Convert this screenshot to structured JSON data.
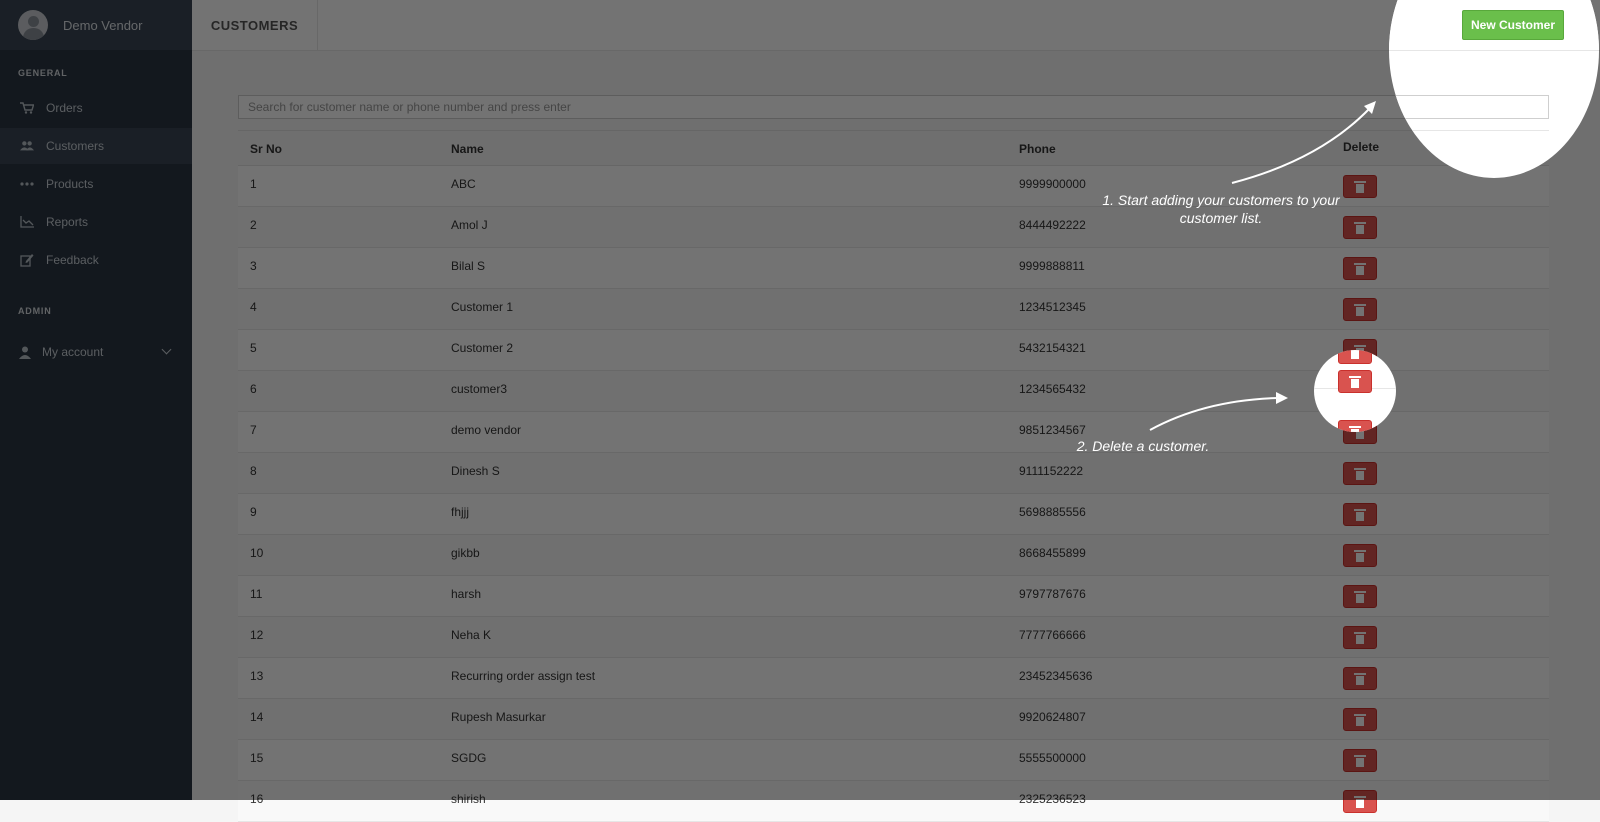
{
  "sidebar": {
    "user_name": "Demo Vendor",
    "section_general": "GENERAL",
    "section_admin": "ADMIN",
    "items": [
      {
        "label": "Orders",
        "icon": "cart-icon"
      },
      {
        "label": "Customers",
        "icon": "users-icon",
        "active": true
      },
      {
        "label": "Products",
        "icon": "dots-icon"
      },
      {
        "label": "Reports",
        "icon": "chart-icon"
      },
      {
        "label": "Feedback",
        "icon": "edit-icon"
      }
    ],
    "account_label": "My account"
  },
  "header": {
    "title": "CUSTOMERS",
    "new_customer_label": "New Customer"
  },
  "search": {
    "placeholder": "Search for customer name or phone number and press enter"
  },
  "table": {
    "columns": [
      "Sr No",
      "Name",
      "Phone",
      "Delete"
    ],
    "rows": [
      {
        "sr": "1",
        "name": "ABC",
        "phone": "9999900000"
      },
      {
        "sr": "2",
        "name": "Amol J",
        "phone": "8444492222"
      },
      {
        "sr": "3",
        "name": "Bilal S",
        "phone": "9999888811"
      },
      {
        "sr": "4",
        "name": "Customer 1",
        "phone": "1234512345"
      },
      {
        "sr": "5",
        "name": "Customer 2",
        "phone": "5432154321"
      },
      {
        "sr": "6",
        "name": "customer3",
        "phone": "1234565432"
      },
      {
        "sr": "7",
        "name": "demo vendor",
        "phone": "9851234567"
      },
      {
        "sr": "8",
        "name": "Dinesh S",
        "phone": "9111152222"
      },
      {
        "sr": "9",
        "name": "fhjjj",
        "phone": "5698885556"
      },
      {
        "sr": "10",
        "name": "gikbb",
        "phone": "8668455899"
      },
      {
        "sr": "11",
        "name": "harsh",
        "phone": "9797787676"
      },
      {
        "sr": "12",
        "name": "Neha K",
        "phone": "7777766666"
      },
      {
        "sr": "13",
        "name": "Recurring order assign test",
        "phone": "23452345636"
      },
      {
        "sr": "14",
        "name": "Rupesh Masurkar",
        "phone": "9920624807"
      },
      {
        "sr": "15",
        "name": "SGDG",
        "phone": "5555500000"
      },
      {
        "sr": "16",
        "name": "shirish",
        "phone": "2325236523"
      }
    ]
  },
  "tour": {
    "step1": "1. Start adding your customers to your customer list.",
    "step2": "2. Delete a customer."
  },
  "colors": {
    "sidebar_bg": "#2b3643",
    "primary_green": "#6abf4b",
    "danger_red": "#d9534f"
  }
}
